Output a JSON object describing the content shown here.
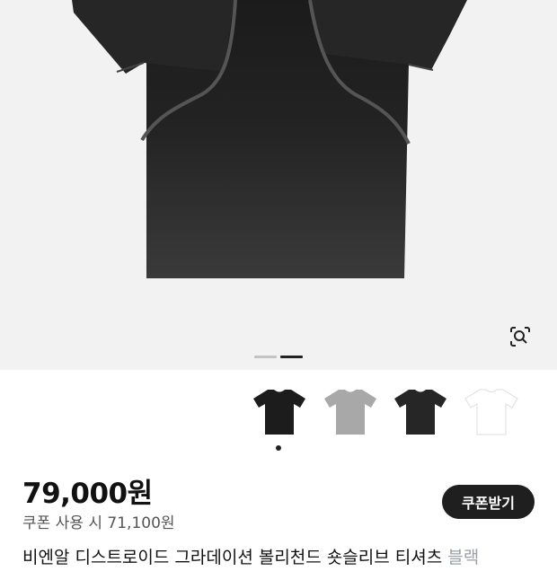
{
  "product": {
    "image_name": "black-distressed-tshirt",
    "gallery_count": 2,
    "gallery_active": 2
  },
  "lens": {
    "icon": "lens-search-icon"
  },
  "variants": [
    {
      "name": "black-tee",
      "color": "#1c1c1c"
    },
    {
      "name": "grey-tee",
      "color": "#a8a8a8"
    },
    {
      "name": "black-faded-tee",
      "color": "#262626"
    },
    {
      "name": "white-tee",
      "color": "#ffffff"
    }
  ],
  "price": {
    "value": "79,000원",
    "coupon_price": "쿠폰 사용 시 71,100원"
  },
  "coupon_button": {
    "label": "쿠폰받기"
  },
  "title": {
    "text": "비엔알 디스트로이드 그라데이션 볼리천드 숏슬리브 티셔츠",
    "brand": "블랙"
  },
  "colors": {
    "hero_bg": "#f2f2f2",
    "button_bg": "#1f1f1f",
    "pager_active": "#222222",
    "pager_inactive": "#c4c4c4",
    "dot": "#222222"
  }
}
